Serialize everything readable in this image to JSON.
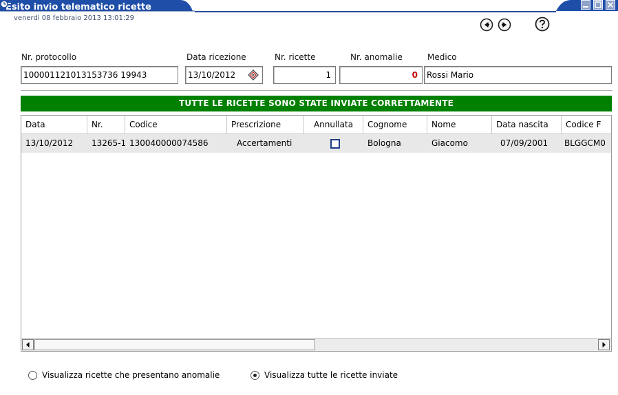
{
  "window": {
    "title": "Esito invio telematico ricette",
    "datetime": "venerdì 08 febbraio 2013   13:01:29"
  },
  "form": {
    "protocol_label": "Nr. protocollo",
    "protocol_value": "100001121013153736 19943",
    "received_label": "Data ricezione",
    "received_value": "13/10/2012",
    "count_label": "Nr. ricette",
    "count_value": "1",
    "anomalies_label": "Nr. anomalie",
    "anomalies_value": "0",
    "doctor_label": "Medico",
    "doctor_value": "Rossi Mario"
  },
  "banner": {
    "text": "TUTTE LE RICETTE SONO STATE INVIATE CORRETTAMENTE",
    "color": "#008000"
  },
  "table": {
    "headers": [
      "Data",
      "Nr.",
      "Codice",
      "Prescrizione",
      "Annullata",
      "Cognome",
      "Nome",
      "Data nascita",
      "Codice F"
    ],
    "rows": [
      {
        "data": "13/10/2012",
        "nr": "13265-1",
        "codice": "130040000074586",
        "prescrizione": "Accertamenti",
        "annullata": false,
        "cognome": "Bologna",
        "nome": "Giacomo",
        "data_nascita": "07/09/2001",
        "codice_f": "BLGGCM0"
      }
    ]
  },
  "options": {
    "anomalies_label": "Visualizza ricette che presentano anomalie",
    "all_label": "Visualizza tutte le ricette inviate",
    "selected": "all"
  },
  "icons": {
    "clock": "clock-icon",
    "back": "arrow-left-icon",
    "forward": "arrow-right-icon",
    "help": "help-icon",
    "calendar": "calendar-icon",
    "minimize": "minimize-icon",
    "maximize": "maximize-icon",
    "close": "close-icon"
  }
}
